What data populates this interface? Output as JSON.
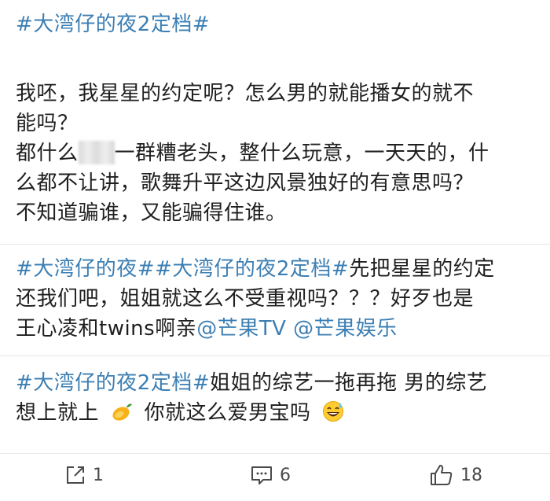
{
  "header": {
    "hashtag": "#大湾仔的夜2定档#"
  },
  "post1": {
    "lines": [
      "我呸，我星星的约定呢？怎么男的就能播女的就不",
      "能吗？",
      "都什么",
      "一群糟老头，整什么玩意，一天天的，什",
      "么都不让讲，歌舞升平这边风景独好的有意思吗？",
      "不知道骗谁，又能骗得住谁。"
    ]
  },
  "post2": {
    "tag1": "#大湾仔的夜#",
    "tag2": "#大湾仔的夜2定档#",
    "line1_text": "先把星星的约定",
    "line2_text": "还我们吧，姐姐就这么不受重视吗？？？好歹也是",
    "line3_text": "王心凌和twins啊亲",
    "mention1": "@芒果TV",
    "mention2": "@芒果娱乐"
  },
  "post3": {
    "tag": "#大湾仔的夜2定档#",
    "line1_text": "姐姐的综艺一拖再拖 男的综艺",
    "line2_a": "想上就上",
    "line2_b": "你就这么爱男宝吗",
    "mango_icon": "mango-emoji",
    "laugh_icon": "grinning-sweat-emoji"
  },
  "actions": {
    "repost_count": "1",
    "comment_count": "6",
    "like_count": "18"
  },
  "colors": {
    "link": "#3d7fb3",
    "text": "#1f1f1f",
    "icon": "#4a4a4a"
  }
}
